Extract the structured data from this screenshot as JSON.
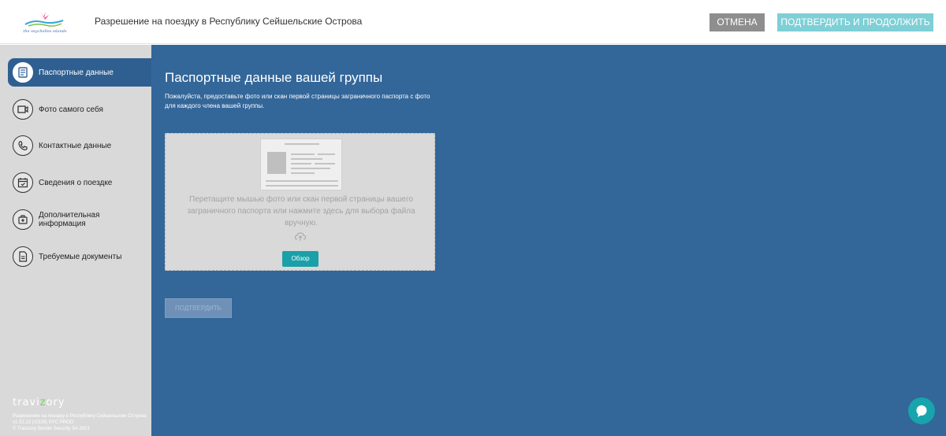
{
  "header": {
    "logo_text": "the seychelles islands",
    "title": "Разрешение на поездку в Республику Сейшельские Острова",
    "cancel_label": "ОТМЕНА",
    "confirm_label": "ПОДТВЕРДИТЬ И ПРОДОЛЖИТЬ"
  },
  "sidebar": {
    "items": [
      {
        "label": "Паспортные данные",
        "icon": "passport-icon",
        "active": true
      },
      {
        "label": "Фото самого себя",
        "icon": "camera-icon",
        "active": false
      },
      {
        "label": "Контактные данные",
        "icon": "phone-icon",
        "active": false
      },
      {
        "label": "Сведения о поездке",
        "icon": "calendar-icon",
        "active": false
      },
      {
        "label": "Дополнительная информация",
        "icon": "medical-bag-icon",
        "active": false
      },
      {
        "label": "Требуемые документы",
        "icon": "document-icon",
        "active": false
      }
    ],
    "brand": "travizory",
    "footer_line1": "Разрешение на поездку в Республику Сейшельские Острова v1.32.13 (r2326) SYC PROD",
    "footer_line2": "© Travizory Border Security SA 2021"
  },
  "main": {
    "title": "Паспортные данные вашей группы",
    "description": "Пожалуйста, предоставьте фото или скан первой страницы заграничного паспорта с фото для каждого члена вашей группы.",
    "dropzone_text": "Перетащите мышью фото или скан первой страницы вашего заграничного паспорта или нажмите здесь для выбора файла вручную.",
    "browse_label": "Обзор",
    "submit_label": "ПОДТВЕРДИТЬ"
  },
  "colors": {
    "main_bg": "#336699",
    "sidebar_bg": "#d9d9d9",
    "accent": "#1aa0a8",
    "confirm_button": "#7ecfd6",
    "cancel_button": "#8e8e8e"
  }
}
